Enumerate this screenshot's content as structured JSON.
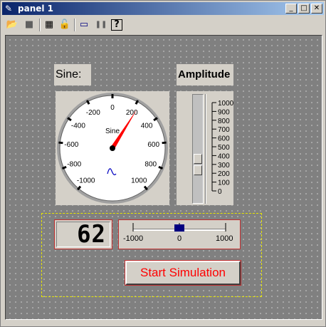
{
  "window": {
    "title": "panel 1",
    "controls": {
      "minimize": "_",
      "maximize": "□",
      "close": "✕"
    }
  },
  "toolbar": {
    "items": [
      {
        "name": "open-folder-icon",
        "glyph": "📂"
      },
      {
        "name": "stop-icon",
        "glyph": "■"
      },
      {
        "name": "grid-icon",
        "glyph": "▦"
      },
      {
        "name": "unlock-icon",
        "glyph": "🔓"
      },
      {
        "name": "window-icon",
        "glyph": "▭"
      },
      {
        "name": "pause-icon",
        "glyph": "❚❚"
      },
      {
        "name": "help-icon",
        "glyph": "?"
      }
    ]
  },
  "sine_label": "Sine:",
  "amplitude_label": "Amplitude",
  "meter": {
    "name": "Sine",
    "value": 230,
    "scale_labels": [
      "-1000",
      "-800",
      "-600",
      "-400",
      "-200",
      "0",
      "200",
      "400",
      "600",
      "800",
      "1000"
    ],
    "needle_color": "#ff0000"
  },
  "amplitude_slider": {
    "scale_labels": [
      "1000",
      "900",
      "800",
      "700",
      "600",
      "500",
      "400",
      "300",
      "200",
      "100",
      "0"
    ],
    "value": 300
  },
  "digital_display": {
    "value": "62"
  },
  "horizontal_slider": {
    "min_label": "-1000",
    "mid_label": "0",
    "max_label": "1000",
    "value": 0,
    "thumb_color": "#000080"
  },
  "start_button": {
    "label": "Start Simulation"
  },
  "colors": {
    "title_bar": "#0a246a",
    "panel_bg": "#808080",
    "control_bg": "#d4d0c8",
    "button_text": "#ff0000",
    "group_border": "#e6e600"
  }
}
